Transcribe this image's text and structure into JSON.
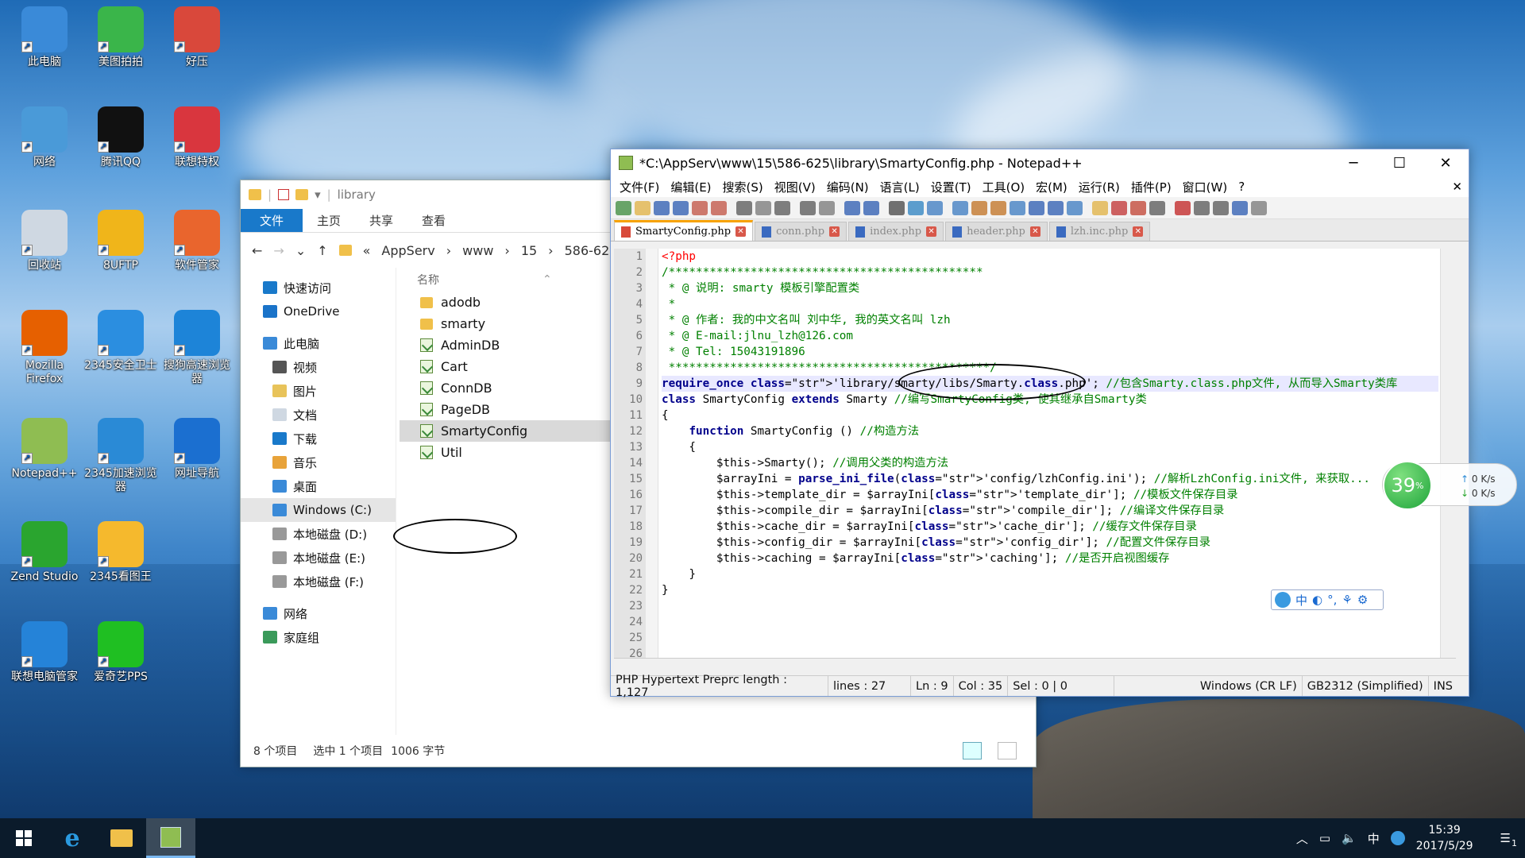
{
  "desktop": {
    "icons": [
      {
        "label": "此电脑",
        "color": "#3a8ad8"
      },
      {
        "label": "美图拍拍",
        "color": "#3ab54a"
      },
      {
        "label": "好压",
        "color": "#d9483b"
      },
      {
        "label": "网络",
        "color": "#4a9ad8"
      },
      {
        "label": "腾讯QQ",
        "color": "#111111"
      },
      {
        "label": "联想特权",
        "color": "#d9363e"
      },
      {
        "label": "回收站",
        "color": "#cfd8e2"
      },
      {
        "label": "8UFTP",
        "color": "#f0b51a"
      },
      {
        "label": "软件管家",
        "color": "#e9652d"
      },
      {
        "label": "Mozilla Firefox",
        "color": "#e66000"
      },
      {
        "label": "2345安全卫士",
        "color": "#2b8ee0"
      },
      {
        "label": "搜狗高速浏览器",
        "color": "#1d84d8"
      },
      {
        "label": "Notepad++",
        "color": "#8fbd52"
      },
      {
        "label": "2345加速浏览器",
        "color": "#2a8ad6"
      },
      {
        "label": "网址导航",
        "color": "#1b6fd0"
      },
      {
        "label": "Zend Studio",
        "color": "#2aa52f"
      },
      {
        "label": "2345看图王",
        "color": "#f5b92d"
      },
      {
        "label": "联想电脑管家",
        "color": "#2583d8"
      },
      {
        "label": "爱奇艺PPS",
        "color": "#1fbf22"
      }
    ]
  },
  "explorer": {
    "title": "library",
    "ribbon": [
      "文件",
      "主页",
      "共享",
      "查看"
    ],
    "address": [
      "«",
      "AppServ",
      "www",
      "15",
      "586-625"
    ],
    "nav": [
      {
        "label": "快速访问",
        "sub": false,
        "color": "#1979ca"
      },
      {
        "label": "OneDrive",
        "sub": false,
        "color": "#1a73c9"
      },
      {
        "label": "此电脑",
        "sub": false,
        "color": "#3a8ad8"
      },
      {
        "label": "视频",
        "sub": true,
        "color": "#555555"
      },
      {
        "label": "图片",
        "sub": true,
        "color": "#e8c35a"
      },
      {
        "label": "文档",
        "sub": true,
        "color": "#cfd8e2"
      },
      {
        "label": "下载",
        "sub": true,
        "color": "#1979ca"
      },
      {
        "label": "音乐",
        "sub": true,
        "color": "#e8a33a"
      },
      {
        "label": "桌面",
        "sub": true,
        "color": "#3a8ad8"
      },
      {
        "label": "Windows (C:)",
        "sub": true,
        "color": "#3a8ad8"
      },
      {
        "label": "本地磁盘 (D:)",
        "sub": true,
        "color": "#999999"
      },
      {
        "label": "本地磁盘 (E:)",
        "sub": true,
        "color": "#999999"
      },
      {
        "label": "本地磁盘 (F:)",
        "sub": true,
        "color": "#999999"
      },
      {
        "label": "网络",
        "sub": false,
        "color": "#3a8ad8"
      },
      {
        "label": "家庭组",
        "sub": false,
        "color": "#3a9a5a"
      }
    ],
    "column_header": "名称",
    "files": [
      {
        "name": "adodb",
        "type": "folder"
      },
      {
        "name": "smarty",
        "type": "folder"
      },
      {
        "name": "AdminDB",
        "type": "php"
      },
      {
        "name": "Cart",
        "type": "php"
      },
      {
        "name": "ConnDB",
        "type": "php"
      },
      {
        "name": "PageDB",
        "type": "php"
      },
      {
        "name": "SmartyConfig",
        "type": "php"
      },
      {
        "name": "Util",
        "type": "php"
      }
    ],
    "status": {
      "count": "8 个项目",
      "selected": "选中 1 个项目",
      "size": "1006 字节"
    }
  },
  "notepad": {
    "title": "*C:\\AppServ\\www\\15\\586-625\\library\\SmartyConfig.php - Notepad++",
    "menu": [
      "文件(F)",
      "编辑(E)",
      "搜索(S)",
      "视图(V)",
      "编码(N)",
      "语言(L)",
      "设置(T)",
      "工具(O)",
      "宏(M)",
      "运行(R)",
      "插件(P)",
      "窗口(W)",
      "?"
    ],
    "tabs": [
      "SmartyConfig.php",
      "conn.php",
      "index.php",
      "header.php",
      "lzh.inc.php"
    ],
    "lines": [
      "<?php",
      "/**********************************************",
      " * @ 说明: smarty 模板引擎配置类",
      " *",
      " * @ 作者: 我的中文名叫 刘中华, 我的英文名叫 lzh",
      " * @ E-mail:jlnu_lzh@126.com",
      " * @ Tel: 15043191896",
      " ***********************************************/",
      "require_once 'library/smarty/libs/Smarty.class.php'; //包含Smarty.class.php文件, 从而导入Smarty类库",
      "class SmartyConfig extends Smarty //编写SmartyConfig类, 使其继承自Smarty类",
      "{",
      "    function SmartyConfig () //构造方法",
      "    {",
      "        $this->Smarty(); //调用父类的构造方法",
      "        $arrayIni = parse_ini_file('config/lzhConfig.ini'); //解析LzhConfig.ini文件, 来获取...",
      "        $this->template_dir = $arrayIni['template_dir']; //模板文件保存目录",
      "        $this->compile_dir = $arrayIni['compile_dir']; //编译文件保存目录",
      "        $this->cache_dir = $arrayIni['cache_dir']; //缓存文件保存目录",
      "        $this->config_dir = $arrayIni['config_dir']; //配置文件保存目录",
      "        $this->caching = $arrayIni['caching']; //是否开启视图缓存",
      "    }",
      "}",
      "",
      "",
      "",
      ""
    ],
    "line_numbers": [
      "1",
      "2",
      "3",
      "4",
      "5",
      "6",
      "7",
      "8",
      "9",
      "10",
      "11",
      "12",
      "13",
      "14",
      "15",
      "16",
      "17",
      "18",
      "19",
      "20",
      "21",
      "22",
      "23",
      "24",
      "25",
      "26"
    ],
    "status": {
      "lang": "PHP Hypertext Preprc length : 1,127",
      "lines": "lines : 27",
      "ln": "Ln : 9",
      "col": "Col : 35",
      "sel": "Sel : 0 | 0",
      "eol": "Windows (CR LF)",
      "enc": "GB2312 (Simplified)",
      "ins": "INS"
    }
  },
  "speed": {
    "percent": "39",
    "unit": "%",
    "up": "0 K/s",
    "down": "0 K/s"
  },
  "ime": {
    "label": "中"
  },
  "taskbar": {
    "ime": "中",
    "time": "15:39",
    "date": "2017/5/29",
    "notif": "1"
  }
}
